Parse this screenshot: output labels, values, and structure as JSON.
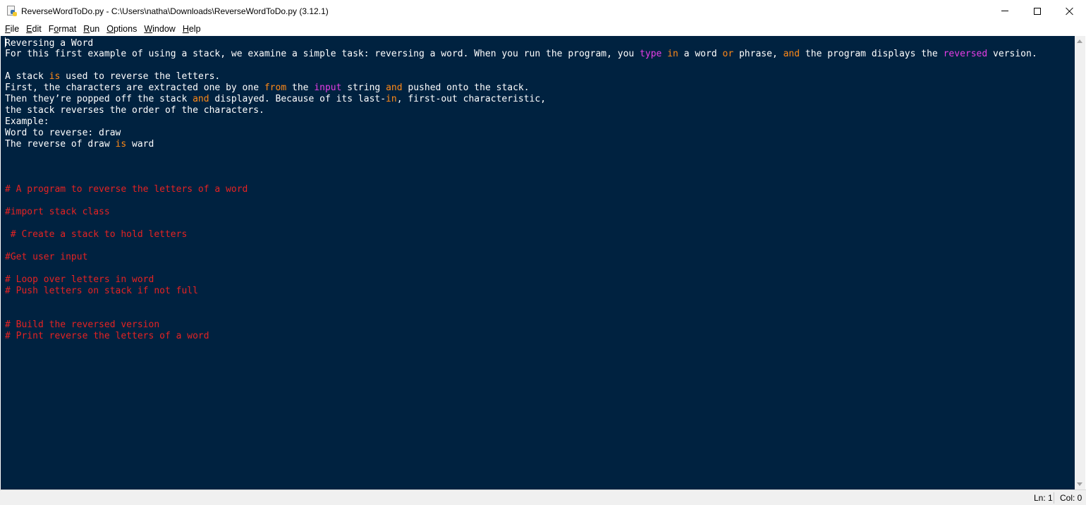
{
  "window": {
    "title": "ReverseWordToDo.py - C:\\Users\\natha\\Downloads\\ReverseWordToDo.py (3.12.1)",
    "app_icon": "python-file-icon"
  },
  "menu": {
    "file": {
      "key": "F",
      "rest": "ile"
    },
    "edit": {
      "key": "E",
      "rest": "dit"
    },
    "format": {
      "pre": "F",
      "key": "o",
      "rest": "rmat"
    },
    "run": {
      "key": "R",
      "rest": "un"
    },
    "options": {
      "key": "O",
      "rest": "ptions"
    },
    "window": {
      "key": "W",
      "rest": "indow"
    },
    "help": {
      "key": "H",
      "rest": "elp"
    }
  },
  "editor": {
    "background": "#002240",
    "keyword_color": "#ff8a17",
    "builtin_color": "#e63de6",
    "comment_color": "#e62222",
    "lines": [
      [
        {
          "t": "Reversing a Word"
        }
      ],
      [
        {
          "t": "For this first example of using a stack, we examine a simple task: reversing a word. When you run the program, you "
        },
        {
          "t": "type",
          "c": "bi"
        },
        {
          "t": " "
        },
        {
          "t": "in",
          "c": "kw"
        },
        {
          "t": " a word "
        },
        {
          "t": "or",
          "c": "kw"
        },
        {
          "t": " phrase, "
        },
        {
          "t": "and",
          "c": "kw"
        },
        {
          "t": " the program displays the "
        },
        {
          "t": "reversed",
          "c": "bi"
        },
        {
          "t": " version."
        }
      ],
      [],
      [
        {
          "t": "A stack "
        },
        {
          "t": "is",
          "c": "kw"
        },
        {
          "t": " used to reverse the letters."
        }
      ],
      [
        {
          "t": "First, the characters are extracted one by one "
        },
        {
          "t": "from",
          "c": "kw"
        },
        {
          "t": " the "
        },
        {
          "t": "input",
          "c": "bi"
        },
        {
          "t": " string "
        },
        {
          "t": "and",
          "c": "kw"
        },
        {
          "t": " pushed onto the stack."
        }
      ],
      [
        {
          "t": "Then they’re popped off the stack "
        },
        {
          "t": "and",
          "c": "kw"
        },
        {
          "t": " displayed. Because of its last-"
        },
        {
          "t": "in",
          "c": "kw"
        },
        {
          "t": ", first-out characteristic,"
        }
      ],
      [
        {
          "t": "the stack reverses the order of the characters."
        }
      ],
      [
        {
          "t": "Example:"
        }
      ],
      [
        {
          "t": "Word to reverse: draw"
        }
      ],
      [
        {
          "t": "The reverse of draw "
        },
        {
          "t": "is",
          "c": "kw"
        },
        {
          "t": " ward"
        }
      ],
      [],
      [],
      [],
      [
        {
          "t": "# A program to reverse the letters of a word",
          "c": "cm"
        }
      ],
      [],
      [
        {
          "t": "#import stack class",
          "c": "cm"
        }
      ],
      [],
      [
        {
          "t": " # Create a stack to hold letters",
          "c": "cm"
        }
      ],
      [],
      [
        {
          "t": "#Get user input",
          "c": "cm"
        }
      ],
      [],
      [
        {
          "t": "# Loop over letters in word",
          "c": "cm"
        }
      ],
      [
        {
          "t": "# Push letters on stack if not full",
          "c": "cm"
        }
      ],
      [],
      [],
      [
        {
          "t": "# Build the reversed version",
          "c": "cm"
        }
      ],
      [
        {
          "t": "# Print reverse the letters of a word",
          "c": "cm"
        }
      ]
    ]
  },
  "status": {
    "line": "Ln: 1",
    "col": "Col: 0"
  }
}
